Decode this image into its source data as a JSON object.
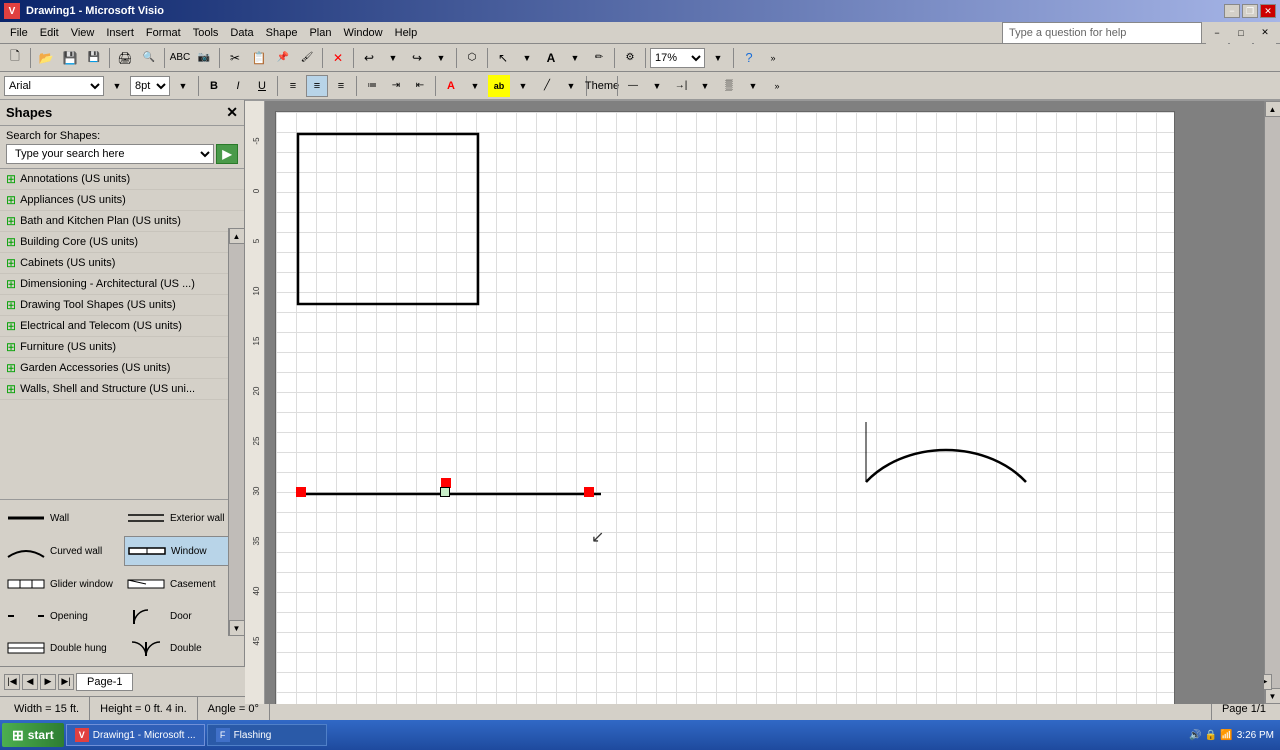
{
  "window": {
    "title": "Drawing1 - Microsoft Visio",
    "app_icon": "V"
  },
  "title_controls": {
    "minimize": "−",
    "restore": "❐",
    "close": "✕",
    "min2": "−",
    "max2": "□",
    "close2": "✕"
  },
  "menu": {
    "items": [
      "File",
      "Edit",
      "View",
      "Insert",
      "Format",
      "Tools",
      "Data",
      "Shape",
      "Plan",
      "Window",
      "Help"
    ]
  },
  "toolbar1": {
    "help_placeholder": "Type a question for help"
  },
  "toolbar2": {
    "zoom": "17%"
  },
  "fmt_toolbar": {
    "font": "Arial",
    "size": "8pt",
    "bold": "B",
    "italic": "I",
    "underline": "U",
    "theme_label": "Theme"
  },
  "shapes_panel": {
    "title": "Shapes",
    "search_label": "Search for Shapes:",
    "search_placeholder": "Type your search here",
    "categories": [
      "Annotations (US units)",
      "Appliances (US units)",
      "Bath and Kitchen Plan (US units)",
      "Building Core (US units)",
      "Cabinets (US units)",
      "Dimensioning - Architectural (US ...)",
      "Drawing Tool Shapes (US units)",
      "Electrical and Telecom (US units)",
      "Furniture (US units)",
      "Garden Accessories (US units)",
      "Walls, Shell and Structure (US uni..."
    ],
    "templates": [
      {
        "name": "Wall",
        "type": "line"
      },
      {
        "name": "Exterior wall",
        "type": "double-line"
      },
      {
        "name": "Curved wall",
        "type": "curve"
      },
      {
        "name": "Window",
        "type": "window"
      },
      {
        "name": "Glider window",
        "type": "glider"
      },
      {
        "name": "Casement",
        "type": "casement"
      },
      {
        "name": "Opening",
        "type": "opening"
      },
      {
        "name": "Door",
        "type": "door"
      },
      {
        "name": "Double hung",
        "type": "dbl-hung"
      },
      {
        "name": "Double",
        "type": "double"
      }
    ]
  },
  "status_bar": {
    "width": "Width = 15 ft.",
    "height": "Height = 0 ft. 4 in.",
    "angle": "Angle = 0°",
    "page": "Page 1/1"
  },
  "page_tab": {
    "name": "Page-1"
  },
  "taskbar": {
    "start": "start",
    "items": [
      {
        "label": "Drawing1 - Microsoft ...",
        "icon": "V"
      },
      {
        "label": "Flashing",
        "icon": "F"
      }
    ],
    "time": "3:26 PM"
  }
}
